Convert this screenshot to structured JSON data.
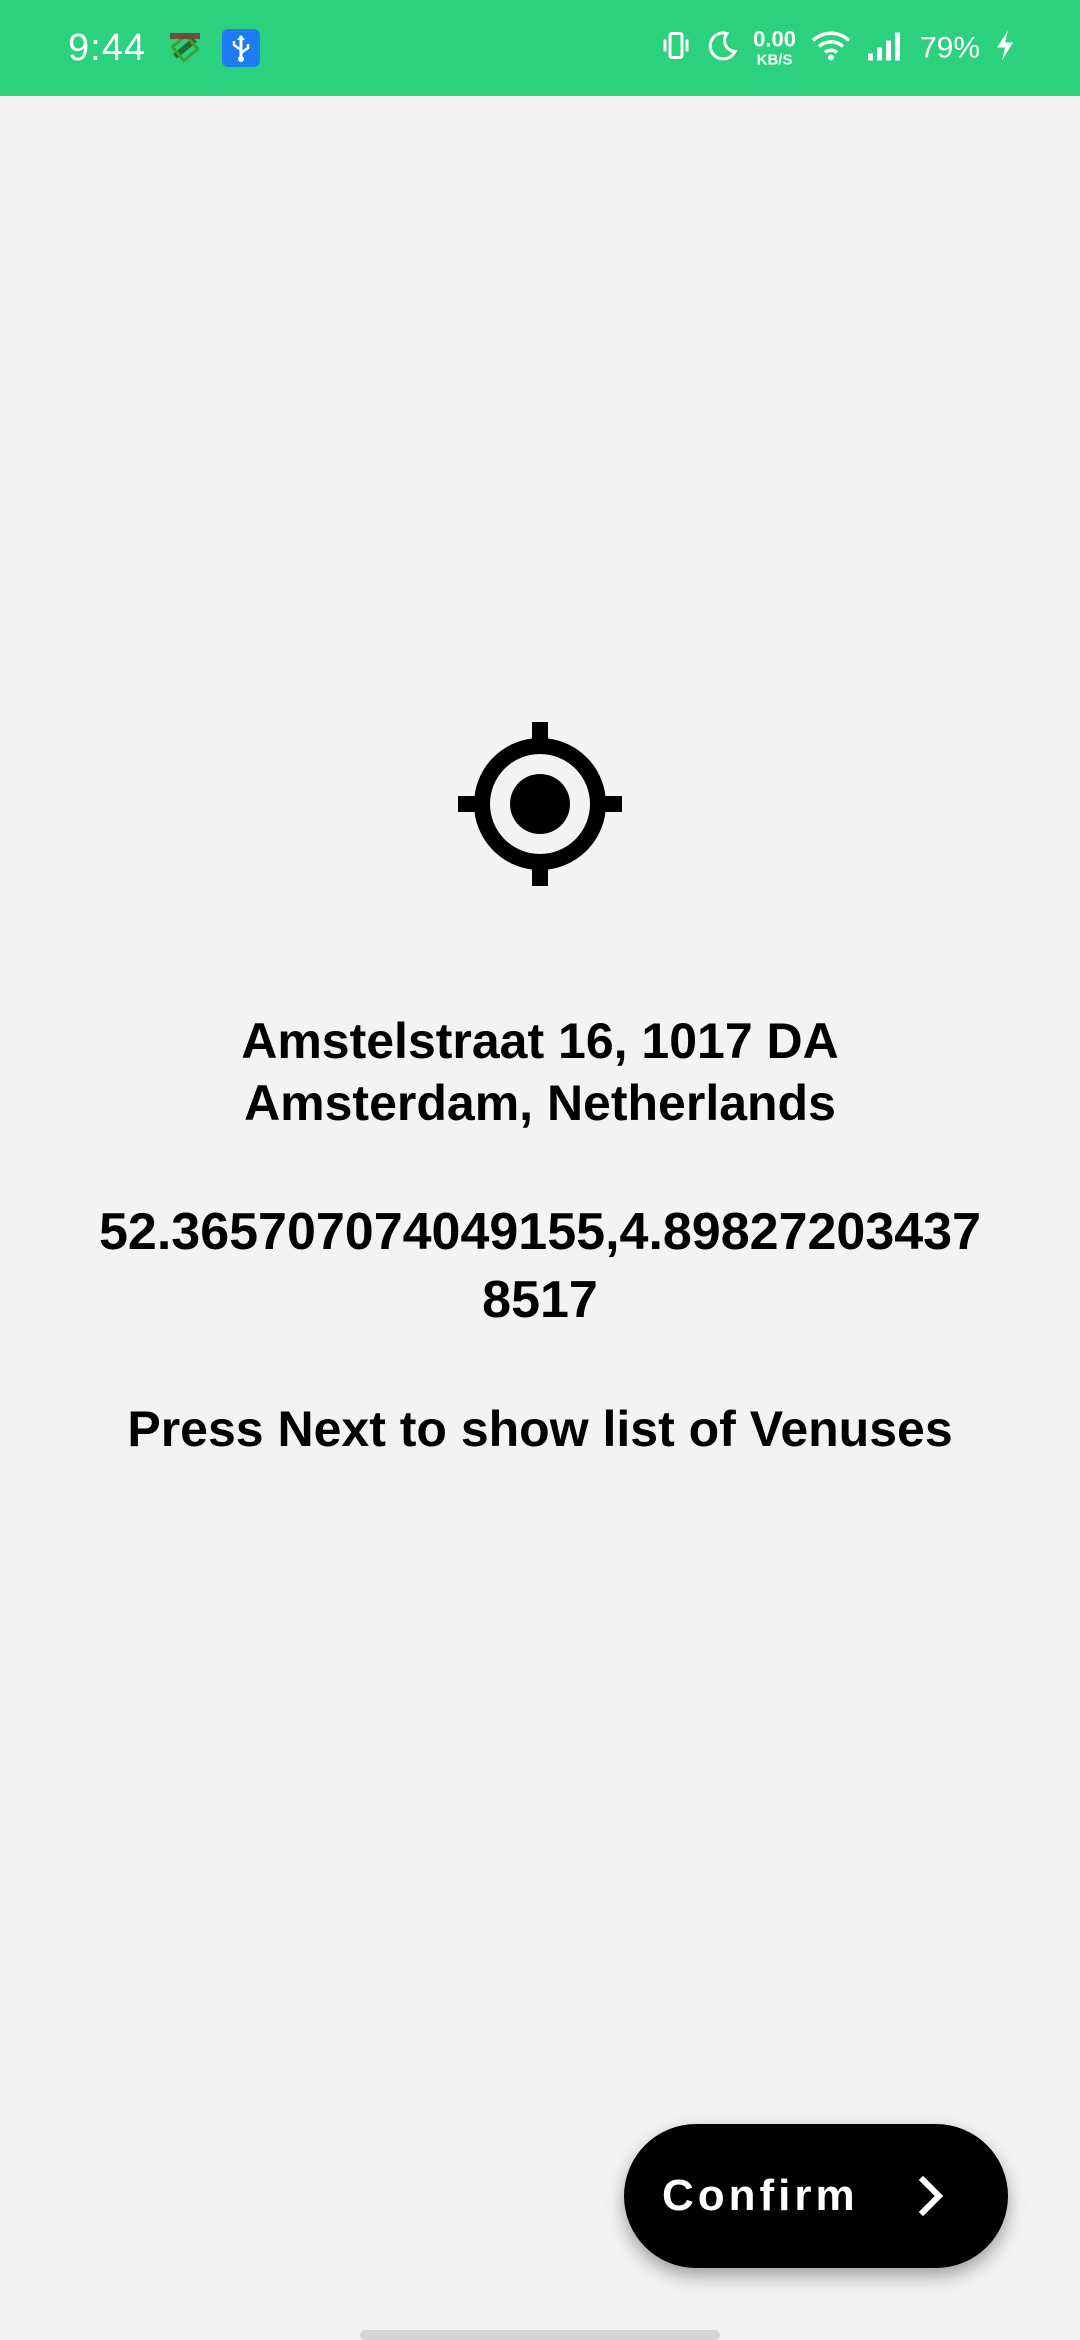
{
  "status_bar": {
    "time": "9:44",
    "net_speed_value": "0.00",
    "net_speed_unit": "KB/S",
    "battery": "79%",
    "icons": [
      "fake-gps-icon",
      "usb-icon",
      "vibrate-icon",
      "do-not-disturb-moon-icon",
      "wifi-icon",
      "signal-icon",
      "charging-icon"
    ],
    "color": "#2bd17f"
  },
  "main": {
    "icon": "gps-target-icon",
    "address": "Amstelstraat 16, 1017 DA Amsterdam, Netherlands",
    "coordinates": "52.365707074049155,4.898272034378517",
    "instruction": "Press Next to show list of Venuses"
  },
  "confirm_button": {
    "label": "Confirm",
    "icon": "chevron-right-icon"
  }
}
